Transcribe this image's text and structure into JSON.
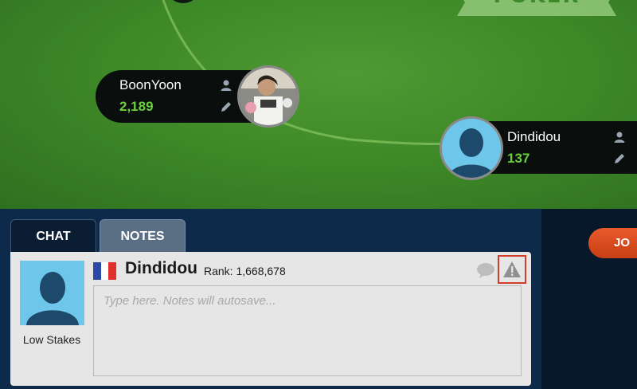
{
  "table": {
    "logo_text": "POKER",
    "colors": {
      "felt": "#3f8a28",
      "chip_green": "#6bcf3f"
    }
  },
  "seats": [
    {
      "name": "BoonYoon",
      "chips": "2,189"
    },
    {
      "name": "Dindidou",
      "chips": "137"
    }
  ],
  "tabs": [
    {
      "label": "CHAT"
    },
    {
      "label": "NOTES"
    }
  ],
  "notes": {
    "player_name": "Dindidou",
    "rank": "Rank: 1,668,678",
    "stakes": "Low Stakes",
    "country": "France",
    "placeholder": "Type here. Notes will autosave..."
  },
  "join_button": {
    "label": "JO"
  },
  "icons": {
    "profile": "person-icon",
    "edit": "pencil-icon",
    "chat": "chat-bubble-icon",
    "report": "warning-icon"
  }
}
